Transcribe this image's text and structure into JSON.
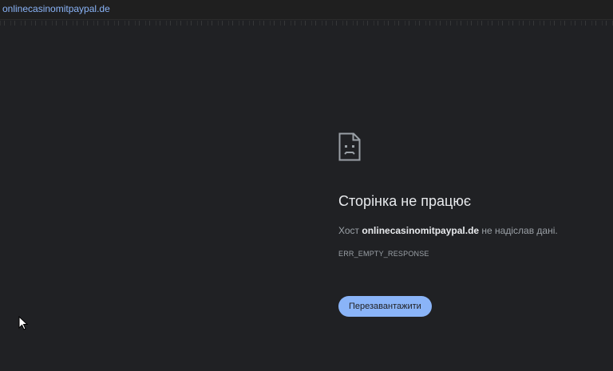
{
  "address_bar": {
    "url": "onlinecasinomitpaypal.de"
  },
  "error_page": {
    "icon": "sad-page-icon",
    "title": "Сторінка не працює",
    "description_prefix": "Хост ",
    "host": "onlinecasinomitpaypal.de",
    "description_suffix": " не надіслав дані.",
    "error_code": "ERR_EMPTY_RESPONSE",
    "reload_label": "Перезавантажити"
  },
  "colors": {
    "background": "#202124",
    "accent": "#8ab4f8",
    "text_primary": "#e8eaed",
    "text_secondary": "#9aa0a6"
  }
}
